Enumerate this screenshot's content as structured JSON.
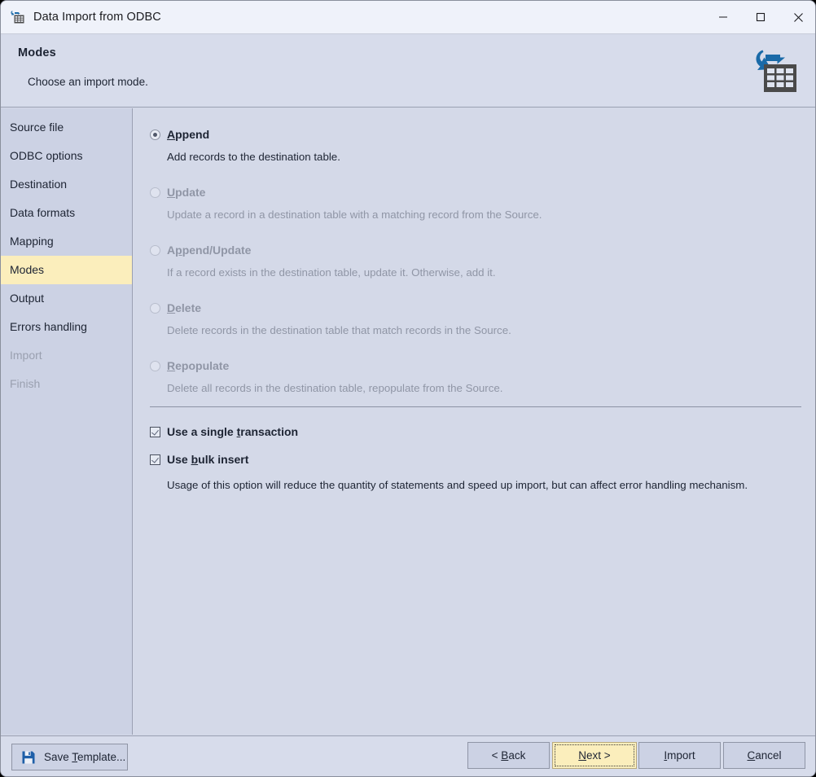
{
  "window": {
    "title": "Data Import from ODBC",
    "icon": "import-table-icon",
    "controls": {
      "minimize": "minimize-icon",
      "maximize": "maximize-icon",
      "close": "close-icon"
    }
  },
  "header": {
    "title": "Modes",
    "subtitle": "Choose an import mode.",
    "icon": "import-table-icon",
    "icon_arrow_color": "#1a6aa8",
    "icon_table_color": "#4a4a4a"
  },
  "sidebar": {
    "items": [
      {
        "label": "Source file",
        "state": "normal"
      },
      {
        "label": "ODBC options",
        "state": "normal"
      },
      {
        "label": "Destination",
        "state": "normal"
      },
      {
        "label": "Data formats",
        "state": "normal"
      },
      {
        "label": "Mapping",
        "state": "normal"
      },
      {
        "label": "Modes",
        "state": "active"
      },
      {
        "label": "Output",
        "state": "normal"
      },
      {
        "label": "Errors handling",
        "state": "normal"
      },
      {
        "label": "Import",
        "state": "disabled"
      },
      {
        "label": "Finish",
        "state": "disabled"
      }
    ],
    "active_background": "#fbeebc"
  },
  "modes": {
    "selected": "Append",
    "options": [
      {
        "label_pre": "",
        "label_key": "A",
        "label_post": "ppend",
        "description": "Add records to the destination table.",
        "selected": true,
        "enabled": true
      },
      {
        "label_pre": "",
        "label_key": "U",
        "label_post": "pdate",
        "description": "Update a record in a destination table with a matching record from the Source.",
        "selected": false,
        "enabled": false
      },
      {
        "label_pre": "A",
        "label_key": "p",
        "label_post": "pend/Update",
        "description": "If a record exists in the destination table, update it. Otherwise, add it.",
        "selected": false,
        "enabled": false
      },
      {
        "label_pre": "",
        "label_key": "D",
        "label_post": "elete",
        "description": "Delete records in the destination table that match records in the Source.",
        "selected": false,
        "enabled": false
      },
      {
        "label_pre": "",
        "label_key": "R",
        "label_post": "epopulate",
        "description": "Delete all records in the destination table, repopulate from the Source.",
        "selected": false,
        "enabled": false
      }
    ]
  },
  "options": {
    "single_transaction": {
      "label_pre": "Use a single ",
      "label_key": "t",
      "label_post": "ransaction",
      "checked": true
    },
    "bulk_insert": {
      "label_pre": "Use ",
      "label_key": "b",
      "label_post": "ulk insert",
      "checked": true,
      "note": "Usage of this option will reduce the quantity of statements and speed up import, but can affect error handling mechanism."
    }
  },
  "footer": {
    "save_template": {
      "pre": "Save ",
      "key": "T",
      "post": "emplate...",
      "icon": "floppy-disk-icon"
    },
    "back": {
      "pre": "< ",
      "key": "B",
      "post": "ack"
    },
    "next": {
      "pre": "",
      "key": "N",
      "post": "ext >",
      "default": true,
      "focused": true
    },
    "import": {
      "pre": "",
      "key": "I",
      "post": "mport"
    },
    "cancel": {
      "pre": "",
      "key": "C",
      "post": "ancel"
    }
  },
  "colors": {
    "titlebar": "#eff2fa",
    "header": "#d7dceb",
    "sidebar": "#ccd2e4",
    "content": "#d4d9e8",
    "accent_yellow": "#fbeebc",
    "accent_blue": "#1a6aa8",
    "text": "#1d2433",
    "text_disabled": "#9096a6"
  }
}
